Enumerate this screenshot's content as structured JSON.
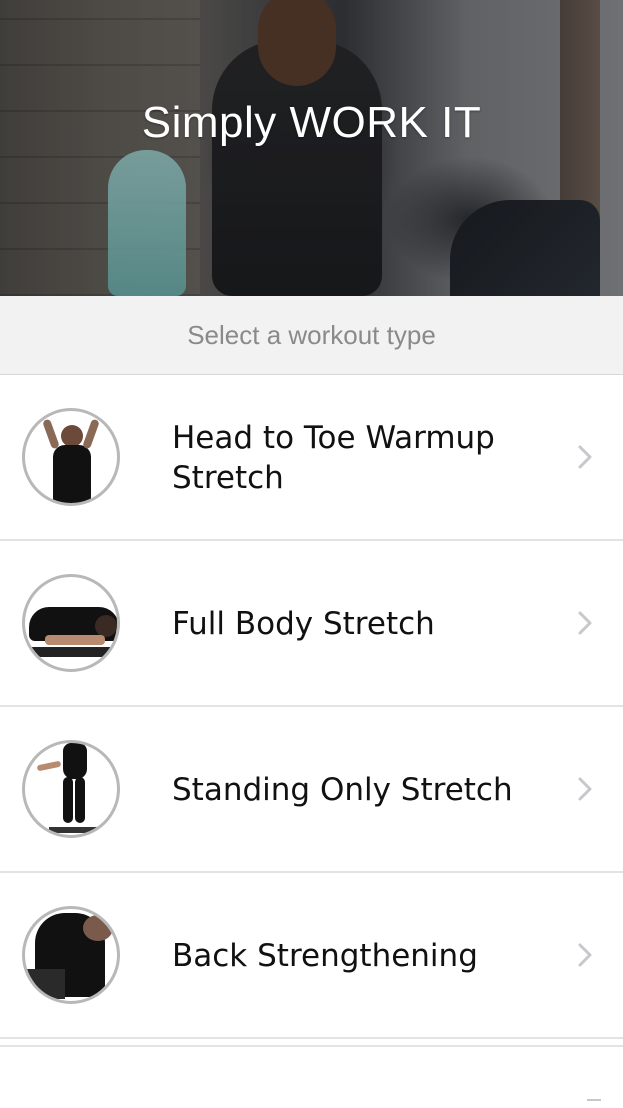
{
  "header": {
    "app_title": "Simply WORK IT",
    "hero_image": "athletes-stretching-outdoors"
  },
  "subheader": {
    "text": "Select a workout type"
  },
  "workouts": [
    {
      "label": "Head to Toe Warmup Stretch",
      "thumbnail_icon": "woman-standing-stretch-thumbnail",
      "chevron_icon": "chevron-right-icon"
    },
    {
      "label": "Full Body Stretch",
      "thumbnail_icon": "seated-forward-fold-thumbnail",
      "chevron_icon": "chevron-right-icon"
    },
    {
      "label": "Standing Only Stretch",
      "thumbnail_icon": "standing-legs-thumbnail",
      "chevron_icon": "chevron-right-icon"
    },
    {
      "label": "Back Strengthening",
      "thumbnail_icon": "back-exercise-thumbnail",
      "chevron_icon": "chevron-right-icon"
    }
  ],
  "colors": {
    "title_text": "#ffffff",
    "subheader_bg": "#f2f2f2",
    "subheader_text": "#8a8a8a",
    "row_text": "#111111",
    "divider": "#e3e3e3",
    "chevron": "#c7c7cc",
    "thumb_border": "#b8b8b8"
  }
}
